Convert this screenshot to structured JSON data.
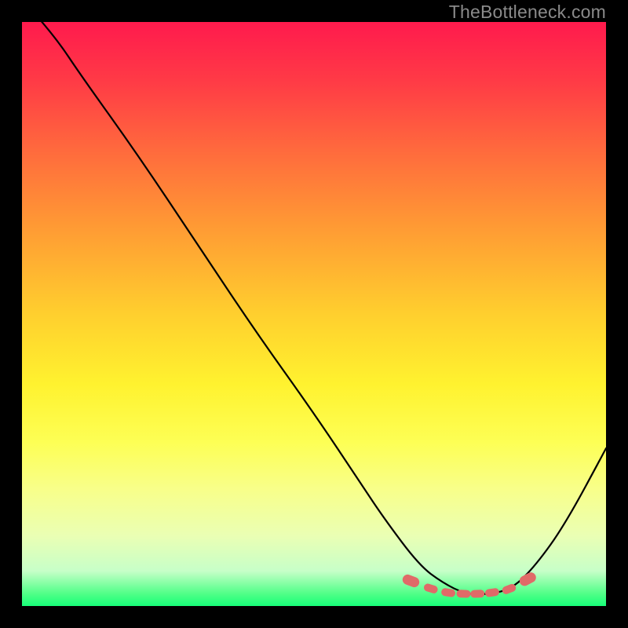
{
  "watermark": "TheBottleneck.com",
  "colors": {
    "background": "#000000",
    "curve_stroke": "#000000",
    "marker_fill": "#e06a68",
    "marker_stroke": "#d44b49"
  },
  "chart_data": {
    "type": "line",
    "title": "",
    "xlabel": "",
    "ylabel": "",
    "xlim": [
      0,
      1
    ],
    "ylim": [
      0,
      1
    ],
    "series": [
      {
        "name": "bottleneck-curve",
        "x": [
          0.0,
          0.06,
          0.1,
          0.2,
          0.3,
          0.4,
          0.5,
          0.58,
          0.62,
          0.68,
          0.72,
          0.76,
          0.8,
          0.84,
          0.88,
          0.93,
          1.0
        ],
        "y": [
          1.04,
          0.97,
          0.91,
          0.77,
          0.62,
          0.47,
          0.33,
          0.21,
          0.15,
          0.07,
          0.04,
          0.02,
          0.02,
          0.03,
          0.07,
          0.14,
          0.27
        ]
      }
    ],
    "markers": {
      "name": "optimal-range-dots",
      "x": [
        0.666,
        0.7,
        0.73,
        0.756,
        0.78,
        0.805,
        0.834,
        0.866
      ],
      "y": [
        0.043,
        0.03,
        0.023,
        0.021,
        0.021,
        0.023,
        0.029,
        0.046
      ]
    }
  }
}
